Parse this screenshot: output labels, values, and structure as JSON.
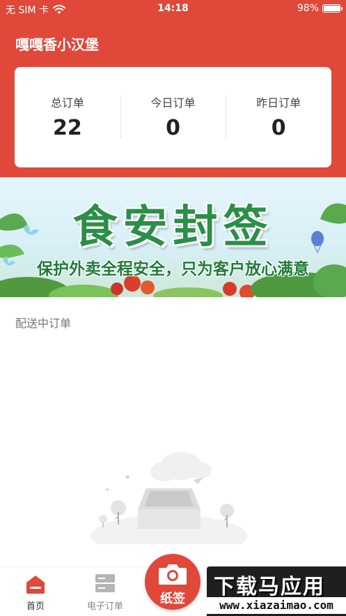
{
  "status_bar": {
    "carrier": "无 SIM 卡",
    "time": "14:18",
    "battery_text": "98%",
    "battery_level": 0.98,
    "wifi_icon": "wifi-icon"
  },
  "header": {
    "shop_name": "嘎嘎香小汉堡"
  },
  "stats": [
    {
      "label": "总订单",
      "value": "22"
    },
    {
      "label": "今日订单",
      "value": "0"
    },
    {
      "label": "昨日订单",
      "value": "0"
    }
  ],
  "banner": {
    "title": "食安封签",
    "subtitle": "保护外卖全程安全，只为客户放心满意"
  },
  "section": {
    "title": "配送中订单"
  },
  "tabs": {
    "home": {
      "label": "首页",
      "icon": "home-icon"
    },
    "e_order": {
      "label": "电子订单",
      "icon": "server-icon"
    },
    "paper": {
      "label": "纸签",
      "icon": "camera-icon"
    }
  },
  "watermark": {
    "cn": "下载马应用",
    "url": "www.xiazaimao.com"
  },
  "colors": {
    "brand": "#e0483a",
    "banner_green": "#2c8f48"
  }
}
